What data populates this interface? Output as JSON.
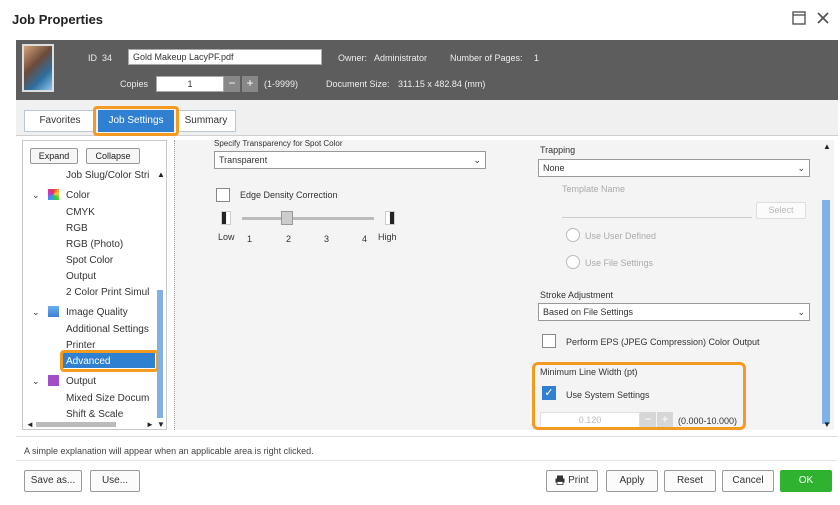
{
  "window": {
    "title": "Job Properties"
  },
  "header": {
    "id_label": "ID",
    "id_value": "34",
    "filename": "Gold Makeup LacyPF.pdf",
    "owner_label": "Owner:",
    "owner_value": "Administrator",
    "pages_label": "Number of Pages:",
    "pages_value": "1",
    "copies_label": "Copies",
    "copies_value": "1",
    "copies_range": "(1-9999)",
    "doc_size_label": "Document Size:",
    "doc_size_value": "311.15 x 482.84 (mm)"
  },
  "tabs": [
    {
      "label": "Favorites"
    },
    {
      "label": "Job Settings"
    },
    {
      "label": "Summary"
    }
  ],
  "tree": {
    "expand_label": "Expand",
    "collapse_label": "Collapse",
    "items": [
      {
        "label": "Job Slug/Color Stri"
      },
      {
        "label": "Color"
      },
      {
        "label": "CMYK"
      },
      {
        "label": "RGB"
      },
      {
        "label": "RGB (Photo)"
      },
      {
        "label": "Spot Color"
      },
      {
        "label": "Output"
      },
      {
        "label": "2 Color Print Simul"
      },
      {
        "label": "Image Quality"
      },
      {
        "label": "Additional Settings"
      },
      {
        "label": "Printer"
      },
      {
        "label": "Advanced"
      },
      {
        "label": "Output"
      },
      {
        "label": "Mixed Size Docum"
      },
      {
        "label": "Shift & Scale"
      }
    ]
  },
  "main": {
    "transparency_label": "Specify Transparency for Spot Color",
    "transparency_value": "Transparent",
    "edge_density_label": "Edge Density Correction",
    "slider_low": "Low",
    "slider_high": "High",
    "slider_ticks": [
      "1",
      "2",
      "3",
      "4"
    ],
    "slider_value": 2,
    "trapping_label": "Trapping",
    "trapping_value": "None",
    "template_name_label": "Template Name",
    "select_button": "Select",
    "use_user_defined": "Use User Defined",
    "use_file_settings": "Use File Settings",
    "stroke_label": "Stroke Adjustment",
    "stroke_value": "Based on File Settings",
    "eps_label": "Perform EPS (JPEG Compression) Color Output",
    "min_line_label": "Minimum Line Width (pt)",
    "use_system_label": "Use System Settings",
    "min_line_value": "0.120",
    "min_line_range": "(0.000-10.000)"
  },
  "footer": {
    "hint": "A simple explanation will appear when an applicable area is right clicked.",
    "save_as": "Save as...",
    "use": "Use...",
    "print": "Print",
    "apply": "Apply",
    "reset": "Reset",
    "cancel": "Cancel",
    "ok": "OK"
  },
  "colors": {
    "accent": "#2f80d0",
    "highlight": "#f39a21",
    "ok": "#2fb22f"
  }
}
